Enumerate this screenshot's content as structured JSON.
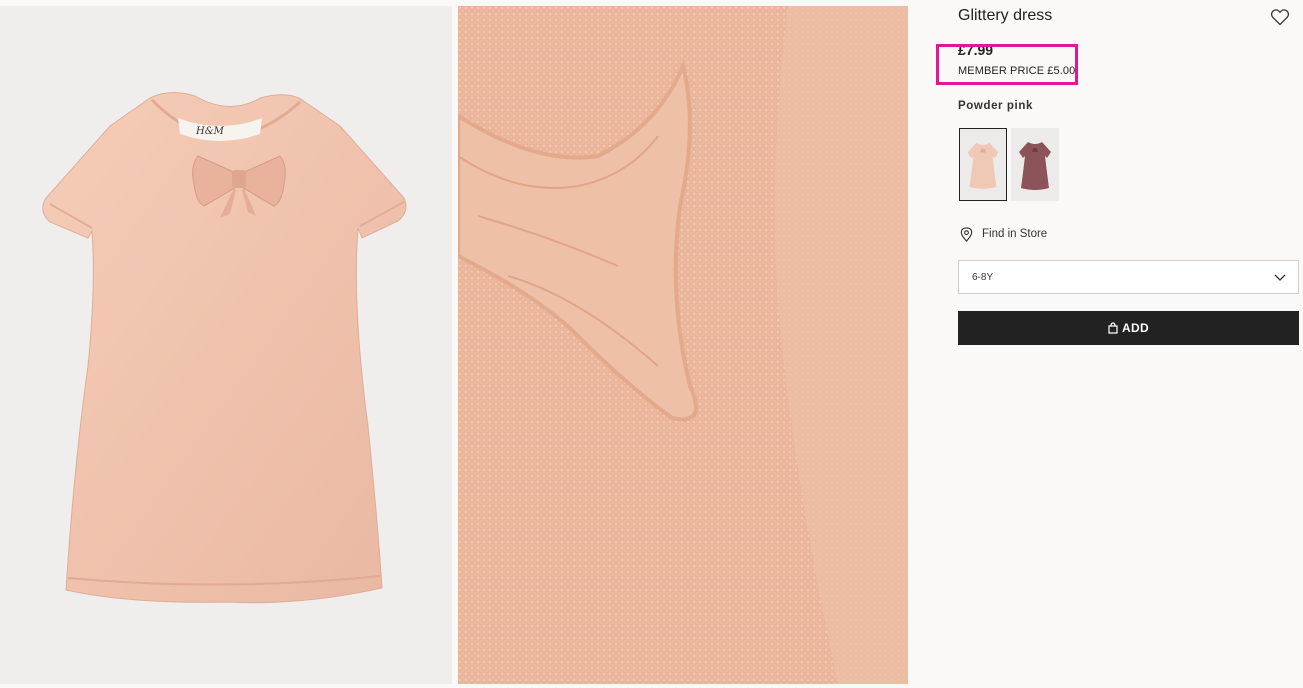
{
  "product": {
    "title": "Glittery dress",
    "price": "£7.99",
    "member_price": "MEMBER PRICE £5.00",
    "color_name": "Powder pink",
    "find_in_store": "Find in Store",
    "size": "6-8Y",
    "add_label": "ADD"
  },
  "images": {
    "main_icon": "dress-front-image",
    "detail_icon": "dress-detail-image",
    "label_text": "H&M"
  },
  "swatches": [
    {
      "name": "Powder pink",
      "icon": "dress-swatch-pink",
      "selected": true
    },
    {
      "name": "Dark mauve",
      "icon": "dress-swatch-mauve",
      "selected": false
    }
  ],
  "colors": {
    "accent_highlight": "#e0179a",
    "button_bg": "#222222",
    "dress_pink": "#f0c2ad",
    "dress_mauve": "#8c5458"
  }
}
